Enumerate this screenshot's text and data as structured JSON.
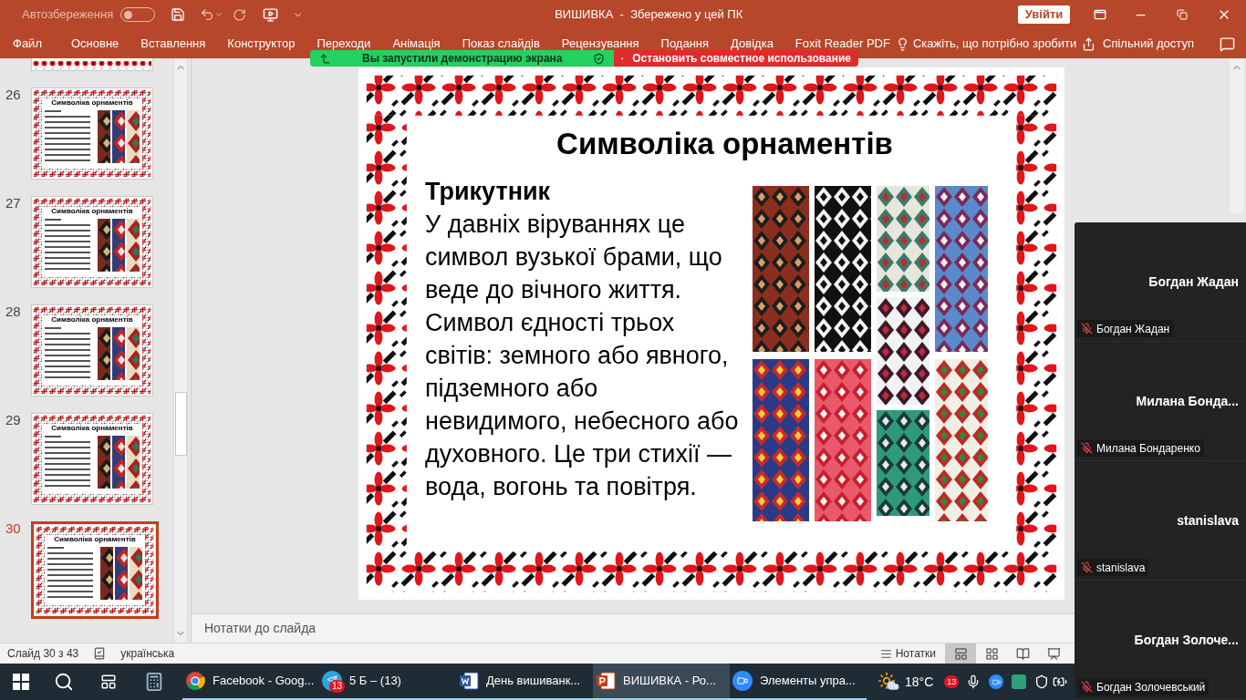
{
  "title_bar": {
    "autosave_label": "Автозбереження",
    "autosave_on": false,
    "document_title": "ВИШИВКА  -  Збережено у цей ПК",
    "sign_in": "Увійти"
  },
  "ribbon_tabs": [
    {
      "label": "Файл",
      "selected": false
    },
    {
      "label": "Основне",
      "selected": false
    },
    {
      "label": "Вставлення",
      "selected": false
    },
    {
      "label": "Конструктор",
      "selected": false
    },
    {
      "label": "Переходи",
      "selected": false
    },
    {
      "label": "Анімація",
      "selected": false
    },
    {
      "label": "Показ слайдів",
      "selected": false
    },
    {
      "label": "Рецензування",
      "selected": false
    },
    {
      "label": "Подання",
      "selected": false
    },
    {
      "label": "Довідка",
      "selected": false
    },
    {
      "label": "Foxit Reader PDF",
      "selected": false
    }
  ],
  "tell_me": "Скажіть, що потрібно зробити",
  "share": "Спільний доступ",
  "share_banner": {
    "status": "Вы запустили демонстрацию экрана",
    "stop": "Остановить совместное использование"
  },
  "thumbnails": [
    {
      "number": "26",
      "title": "Символіка орнаментів",
      "selected": false
    },
    {
      "number": "27",
      "title": "Символіка орнаментів",
      "selected": false
    },
    {
      "number": "28",
      "title": "Символіка орнаментів",
      "selected": false
    },
    {
      "number": "29",
      "title": "Символіка орнаментів",
      "selected": false
    },
    {
      "number": "30",
      "title": "Символіка орнаментів",
      "selected": true
    }
  ],
  "slide": {
    "title": "Символіка орнаментів",
    "heading": "Трикутник",
    "body": "У давніх віруваннях це символ вузької брами, що веде до вічного життя. Символ єдності трьох світів: земного або явного, підземного або невидимого, небесного або духовного. Це три стихії — вода, вогонь та повітря."
  },
  "notes_placeholder": "Нотатки до слайда",
  "status_bar": {
    "slide_counter": "Слайд 30 з 43",
    "language": "українська",
    "notes": "Нотатки",
    "views": [
      {
        "kind": "normal",
        "selected": true
      },
      {
        "kind": "sorter",
        "selected": false
      },
      {
        "kind": "reading",
        "selected": false
      },
      {
        "kind": "slideshow",
        "selected": false
      }
    ]
  },
  "taskbar": {
    "apps": [
      {
        "kind": "chrome",
        "label": "Facebook - Goog...",
        "selected": false
      },
      {
        "kind": "telegram",
        "label": "5 Б – (13)",
        "badge": "13",
        "selected": false
      },
      {
        "kind": "word",
        "label": "День вишиванк...",
        "selected": false
      },
      {
        "kind": "powerpoint",
        "label": "ВИШИВКА - Ро...",
        "selected": true
      },
      {
        "kind": "zoom",
        "label": "Элементы упра...",
        "selected": false
      }
    ],
    "weather": "18°C",
    "tray_badge": "13"
  },
  "participants": [
    {
      "display_name": "Богдан Жадан",
      "label": "Богдан Жадан",
      "muted": true
    },
    {
      "display_name": "Милана Бонда...",
      "label": "Милана Бондаренко",
      "muted": true
    },
    {
      "display_name": "stanislava",
      "label": "stanislava",
      "muted": true
    },
    {
      "display_name": "Богдан Золоче...",
      "label": "Богдан Золочевський",
      "muted": true
    }
  ]
}
